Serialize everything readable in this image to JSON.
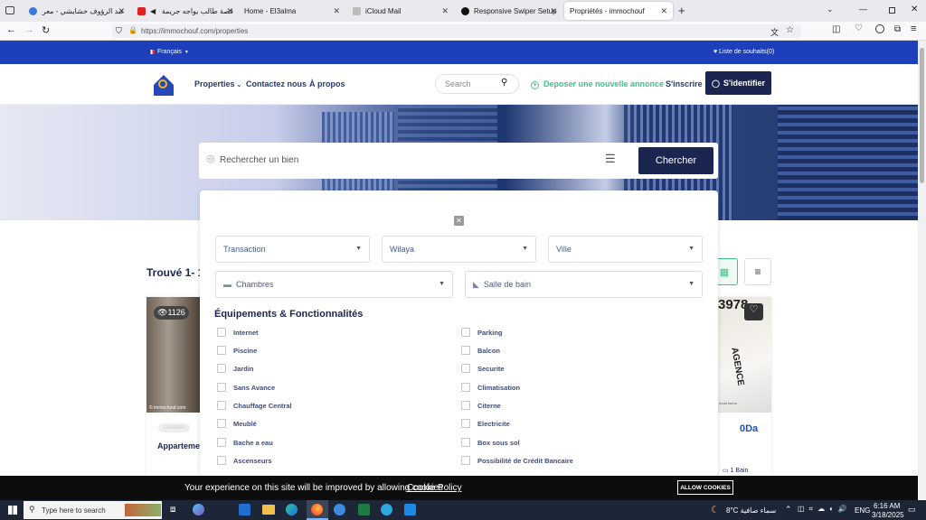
{
  "browser": {
    "tabs": [
      {
        "label": "عبد الرؤوف حشايشي - معرض الأ",
        "color": "#3a79d8"
      },
      {
        "label": "قصة طالب يواجه جريمة قتل",
        "color": "#e02020"
      },
      {
        "label": "Home - El3alma",
        "color": "#999999"
      },
      {
        "label": "iCloud Mail",
        "color": "#888888"
      },
      {
        "label": "Responsive Swiper Setup",
        "color": "#111111"
      },
      {
        "label": "Propriétés - immochouf",
        "color": "#cccccc"
      }
    ],
    "new_tab": "+",
    "url": "https://immochouf.com/properties"
  },
  "topbar": {
    "language": "Français",
    "wishlist": "Liste de souhaits(0)"
  },
  "header": {
    "logo_text": "Immo Chouf",
    "nav": [
      "Properties",
      "Contactez nous",
      "À propos"
    ],
    "search_placeholder": "Search",
    "post_ad": "Deposer une nouvelle annonce",
    "register": "S'inscrire",
    "login": "S'identifier"
  },
  "hero": {
    "search_placeholder": "Rechercher un bien",
    "search_button": "Chercher"
  },
  "filters": {
    "close": "✕",
    "transaction": "Transaction",
    "wilaya": "Wilaya",
    "ville": "Ville",
    "chambres": "Chambres",
    "salle_de_bain": "Salle de bain",
    "features_title": "Équipements & Fonctionnalités",
    "features_left": [
      "Internet",
      "Piscine",
      "Jardin",
      "Sans Avance",
      "Chauffage Central",
      "Meublé",
      "Bache a eau",
      "Ascenseurs"
    ],
    "features_right": [
      "Parking",
      "Balcon",
      "Securite",
      "Climatisation",
      "Citerne",
      "Electricite",
      "Box sous sol",
      "Possibilité de Crédit Bancaire"
    ]
  },
  "listing": {
    "found": "Trouvé 1- 1(",
    "card1": {
      "views": "1126",
      "tag": "Location",
      "title": "Appartemen",
      "watermark": "© immochouf.com"
    },
    "card2": {
      "number": "3978",
      "sign": "AGENCE",
      "price": "0Da",
      "baths": "1 Bain",
      "caption": "houd immo"
    }
  },
  "cookie": {
    "text": "Your experience on this site will be improved by allowing cookies",
    "link": "Cookie Policy",
    "button": "ALLOW COOKIES"
  },
  "taskbar": {
    "search": "Type here to search",
    "weather": "8°C  سماء صافية",
    "lang": "ENG",
    "time": "6:16 AM",
    "date": "3/18/2025"
  }
}
